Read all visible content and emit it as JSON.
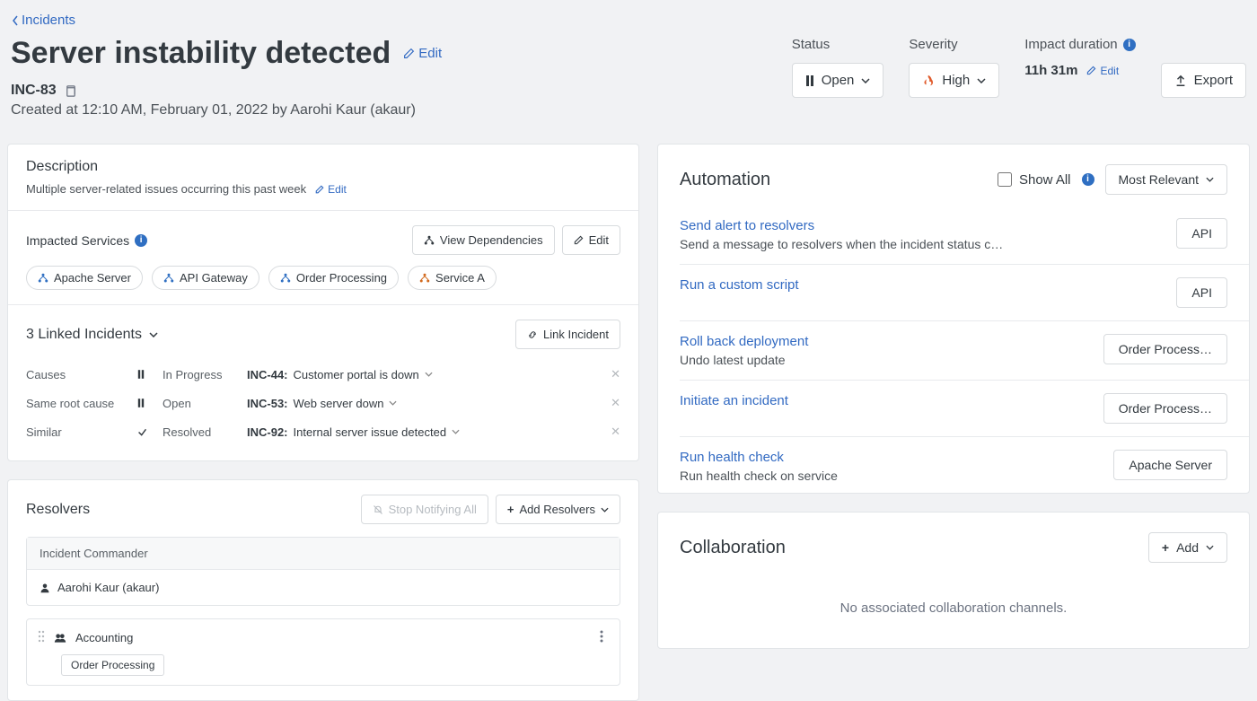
{
  "breadcrumb": "Incidents",
  "title": "Server instability detected",
  "editLabel": "Edit",
  "incidentId": "INC-83",
  "createdLine": "Created at 12:10 AM, February 01, 2022 by Aarohi Kaur (akaur)",
  "headerMeta": {
    "status": {
      "label": "Status",
      "value": "Open"
    },
    "severity": {
      "label": "Severity",
      "value": "High"
    },
    "impact": {
      "label": "Impact duration",
      "value": "11h 31m",
      "editLabel": "Edit"
    },
    "exportLabel": "Export"
  },
  "description": {
    "title": "Description",
    "text": "Multiple server-related issues occurring this past week",
    "editLabel": "Edit"
  },
  "impacted": {
    "title": "Impacted Services",
    "viewDepsLabel": "View Dependencies",
    "editLabel": "Edit",
    "services": [
      {
        "name": "Apache Server",
        "color": "blue"
      },
      {
        "name": "API Gateway",
        "color": "blue"
      },
      {
        "name": "Order Processing",
        "color": "blue"
      },
      {
        "name": "Service A",
        "color": "orange"
      }
    ]
  },
  "linked": {
    "title": "3 Linked Incidents",
    "linkBtn": "Link Incident",
    "rows": [
      {
        "relation": "Causes",
        "status": "In Progress",
        "icon": "pause",
        "id": "INC-44",
        "name": "Customer portal is down"
      },
      {
        "relation": "Same root cause",
        "status": "Open",
        "icon": "pause",
        "id": "INC-53",
        "name": "Web server down"
      },
      {
        "relation": "Similar",
        "status": "Resolved",
        "icon": "check",
        "id": "INC-92",
        "name": "Internal server issue detected"
      }
    ]
  },
  "resolvers": {
    "title": "Resolvers",
    "stopLabel": "Stop Notifying All",
    "addLabel": "Add Resolvers",
    "commanderLabel": "Incident Commander",
    "commanderName": "Aarohi Kaur (akaur)",
    "groupName": "Accounting",
    "groupTag": "Order Processing"
  },
  "automation": {
    "title": "Automation",
    "showAllLabel": "Show All",
    "sortLabel": "Most Relevant",
    "items": [
      {
        "name": "Send alert to resolvers",
        "desc": "Send a message to resolvers when the incident status c…",
        "tag": "API"
      },
      {
        "name": "Run a custom script",
        "desc": "",
        "tag": "API"
      },
      {
        "name": "Roll back deployment",
        "desc": "Undo latest update",
        "tag": "Order Process…"
      },
      {
        "name": "Initiate an incident",
        "desc": "",
        "tag": "Order Process…"
      },
      {
        "name": "Run health check",
        "desc": "Run health check on service",
        "tag": "Apache Server"
      }
    ]
  },
  "collab": {
    "title": "Collaboration",
    "addLabel": "Add",
    "emptyText": "No associated collaboration channels."
  }
}
